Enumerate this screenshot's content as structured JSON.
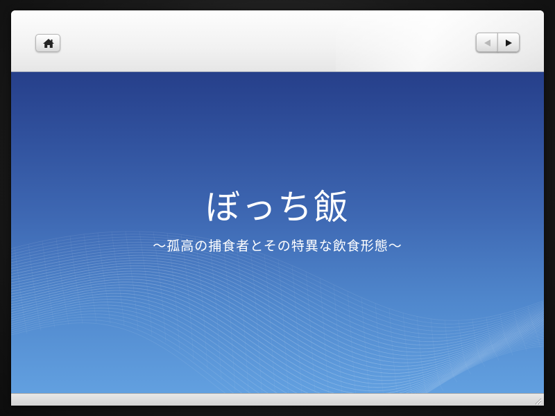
{
  "toolbar": {
    "home_icon": "home-icon",
    "prev_icon": "triangle-left-icon",
    "next_icon": "triangle-right-icon"
  },
  "slide": {
    "title": "ぼっち飯",
    "subtitle": "〜孤高の捕食者とその特異な飲食形態〜"
  },
  "colors": {
    "slide_top": "#263f8a",
    "slide_bottom": "#62a0e0",
    "text": "#ffffff",
    "toolbar_bg": "#f3f3f3"
  }
}
